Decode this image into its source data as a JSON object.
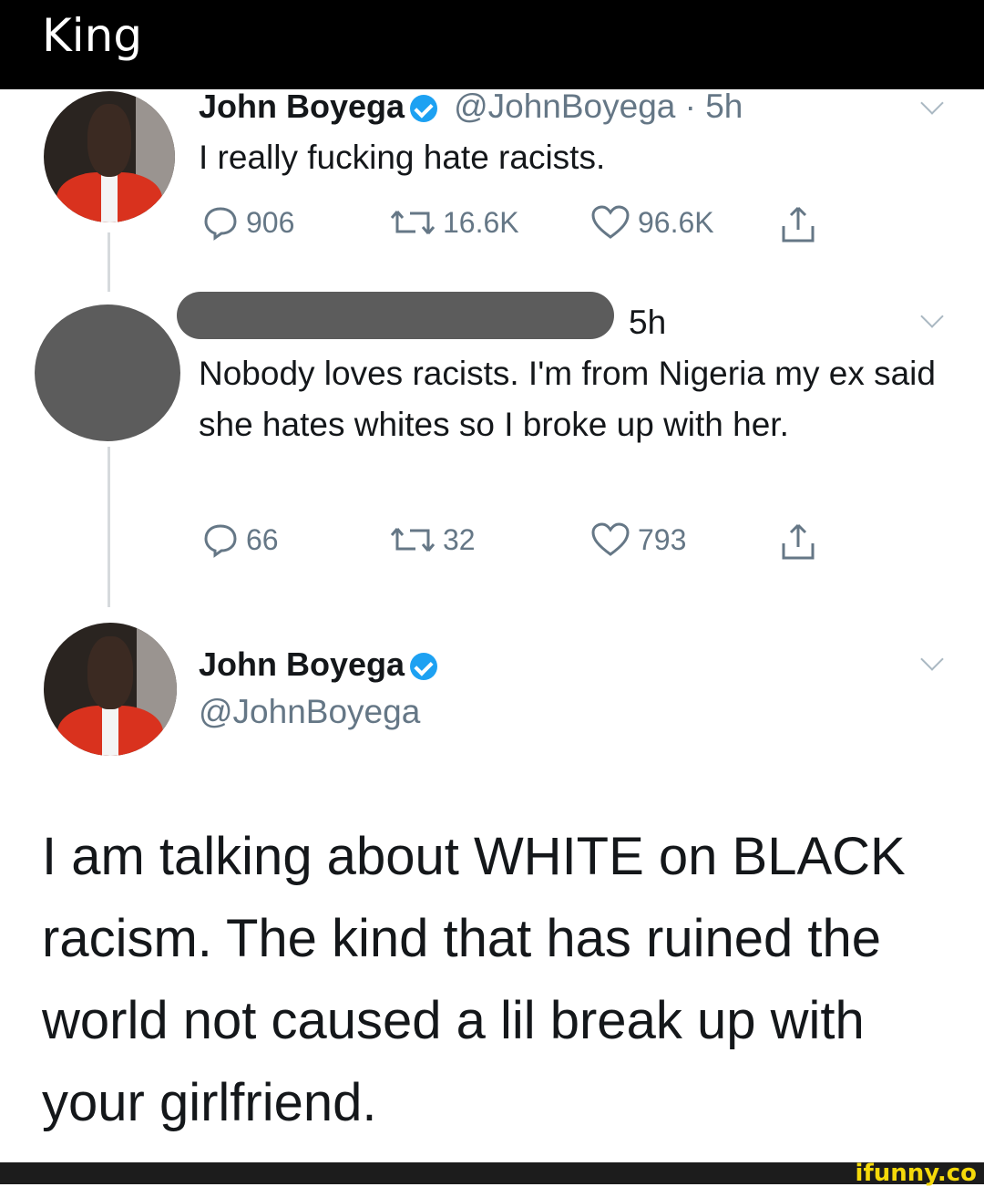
{
  "header": {
    "title": "King"
  },
  "tweet1": {
    "name": "John Boyega",
    "meta": "@JohnBoyega · 5h",
    "text": "I really fucking hate racists.",
    "reply_count": "906",
    "retweet_count": "16.6K",
    "like_count": "96.6K"
  },
  "tweet2": {
    "time": "5h",
    "text": "Nobody loves racists. I'm from Nigeria my ex said she hates whites so I broke up with her.",
    "reply_count": "66",
    "retweet_count": "32",
    "like_count": "793"
  },
  "tweet3": {
    "name": "John Boyega",
    "handle": "@JohnBoyega",
    "text": "I am talking about WHITE on BLACK racism. The kind that has ruined the world not caused a lil break up with your girlfriend."
  },
  "watermark": {
    "text": "ifunny.co"
  },
  "colors": {
    "accent": "#1da1f2",
    "muted": "#657786",
    "watermark": "#f5d90a"
  }
}
